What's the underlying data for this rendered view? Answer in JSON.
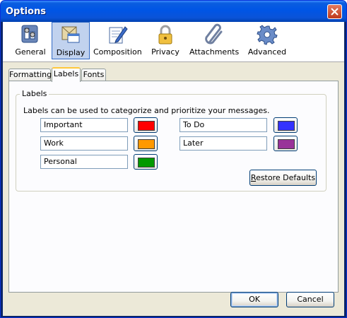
{
  "window": {
    "title": "Options"
  },
  "toolbar": {
    "items": [
      {
        "label": "General",
        "icon": "general-icon"
      },
      {
        "label": "Display",
        "icon": "display-icon",
        "selected": true
      },
      {
        "label": "Composition",
        "icon": "composition-icon"
      },
      {
        "label": "Privacy",
        "icon": "lock-icon"
      },
      {
        "label": "Attachments",
        "icon": "paperclip-icon"
      },
      {
        "label": "Advanced",
        "icon": "gear-icon"
      }
    ]
  },
  "tabs": [
    {
      "label": "Formatting"
    },
    {
      "label": "Labels",
      "active": true
    },
    {
      "label": "Fonts"
    }
  ],
  "labels_group": {
    "title": "Labels",
    "description": "Labels can be used to categorize and prioritize your messages.",
    "labels": [
      {
        "name": "Important",
        "color": "#ff0000"
      },
      {
        "name": "To Do",
        "color": "#3333ff"
      },
      {
        "name": "Work",
        "color": "#ff9900"
      },
      {
        "name": "Later",
        "color": "#993399"
      },
      {
        "name": "Personal",
        "color": "#009900"
      }
    ],
    "restore_first": "R",
    "restore_rest": "estore Defaults"
  },
  "buttons": {
    "ok": "OK",
    "cancel": "Cancel"
  }
}
